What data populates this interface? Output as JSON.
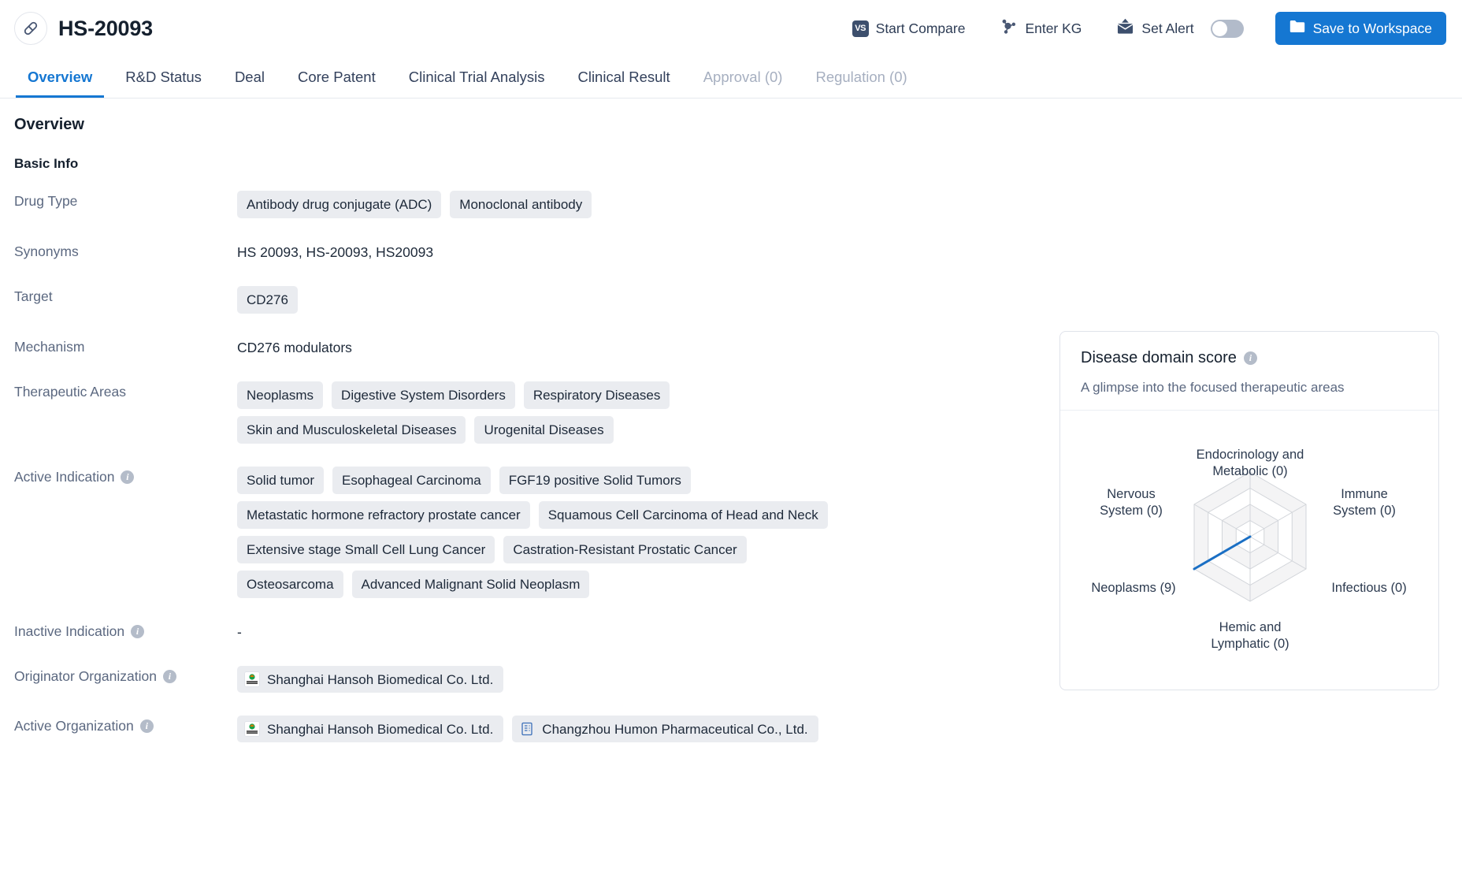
{
  "header": {
    "drug_name": "HS-20093",
    "drug_icon": "capsule-icon",
    "actions": [
      {
        "label": "Start Compare",
        "icon": "vs-badge-icon",
        "badge": "VS"
      },
      {
        "label": "Enter KG",
        "icon": "knowledge-graph-icon"
      },
      {
        "label": "Set Alert",
        "icon": "alert-mail-icon",
        "toggle": "off"
      }
    ],
    "save_button": {
      "label": "Save to Workspace",
      "icon": "folder-icon",
      "color": "#1577d2"
    }
  },
  "tabs": [
    {
      "label": "Overview",
      "state": "active"
    },
    {
      "label": "R&D Status",
      "state": "normal"
    },
    {
      "label": "Deal",
      "state": "normal"
    },
    {
      "label": "Core Patent",
      "state": "normal"
    },
    {
      "label": "Clinical Trial Analysis",
      "state": "normal"
    },
    {
      "label": "Clinical Result",
      "state": "normal"
    },
    {
      "label": "Approval (0)",
      "state": "disabled"
    },
    {
      "label": "Regulation (0)",
      "state": "disabled"
    }
  ],
  "main": {
    "page_title": "Overview",
    "basic_info_title": "Basic Info",
    "rows": [
      {
        "label": "Drug Type",
        "info": false,
        "kind": "chips",
        "values": [
          "Antibody drug conjugate (ADC)",
          "Monoclonal antibody"
        ]
      },
      {
        "label": "Synonyms",
        "info": false,
        "kind": "text",
        "text": "HS 20093,  HS-20093,  HS20093"
      },
      {
        "label": "Target",
        "info": false,
        "kind": "chips",
        "values": [
          "CD276"
        ]
      },
      {
        "label": "Mechanism",
        "info": false,
        "kind": "text",
        "text": "CD276 modulators"
      },
      {
        "label": "Therapeutic Areas",
        "info": false,
        "kind": "chips",
        "values": [
          "Neoplasms",
          "Digestive System Disorders",
          "Respiratory Diseases",
          "Skin and Musculoskeletal Diseases",
          "Urogenital Diseases"
        ]
      },
      {
        "label": "Active Indication",
        "info": true,
        "kind": "chips",
        "values": [
          "Solid tumor",
          "Esophageal Carcinoma",
          "FGF19 positive Solid Tumors",
          "Metastatic hormone refractory prostate cancer",
          "Squamous Cell Carcinoma of Head and Neck",
          "Extensive stage Small Cell Lung Cancer",
          "Castration-Resistant Prostatic Cancer",
          "Osteosarcoma",
          "Advanced Malignant Solid Neoplasm"
        ]
      },
      {
        "label": "Inactive Indication",
        "info": true,
        "kind": "text",
        "text": "-"
      },
      {
        "label": "Originator Organization",
        "info": true,
        "kind": "orgs",
        "orgs": [
          {
            "name": "Shanghai Hansoh Biomedical Co. Ltd.",
            "icon": "hansoh-logo-icon"
          }
        ]
      },
      {
        "label": "Active Organization",
        "info": true,
        "kind": "orgs",
        "orgs": [
          {
            "name": "Shanghai Hansoh Biomedical Co. Ltd.",
            "icon": "hansoh-logo-icon"
          },
          {
            "name": "Changzhou Humon Pharmaceutical Co., Ltd.",
            "icon": "building-icon"
          }
        ]
      }
    ]
  },
  "radar_card": {
    "title": "Disease domain score",
    "subtitle": "A glimpse into the focused therapeutic areas",
    "info_icon": "info-icon"
  },
  "chart_data": {
    "type": "radar",
    "title": "Disease domain score",
    "subtitle": "A glimpse into the focused therapeutic areas",
    "categories": [
      "Endocrinology and\nMetabolic (0)",
      "Immune\nSystem (0)",
      "Infectious (0)",
      "Hemic and\nLymphatic (0)",
      "Neoplasms (9)",
      "Nervous\nSystem (0)"
    ],
    "axis_names": [
      "Endocrinology and Metabolic",
      "Immune System",
      "Infectious",
      "Hemic and Lymphatic",
      "Neoplasms",
      "Nervous System"
    ],
    "values": [
      0,
      0,
      0,
      0,
      9,
      0
    ],
    "rmax": 9,
    "rings": 4,
    "grid": true,
    "legend": "none",
    "series_color": "#1a6fc4",
    "grid_color": "#d2d5da",
    "ring_fill": "#f4f4f5"
  },
  "colors": {
    "accent": "#1577d2",
    "chip_bg": "#eaecf0",
    "label_text": "#5b6880",
    "value_text": "#1d2939",
    "disabled_tab": "#a6afc0"
  }
}
